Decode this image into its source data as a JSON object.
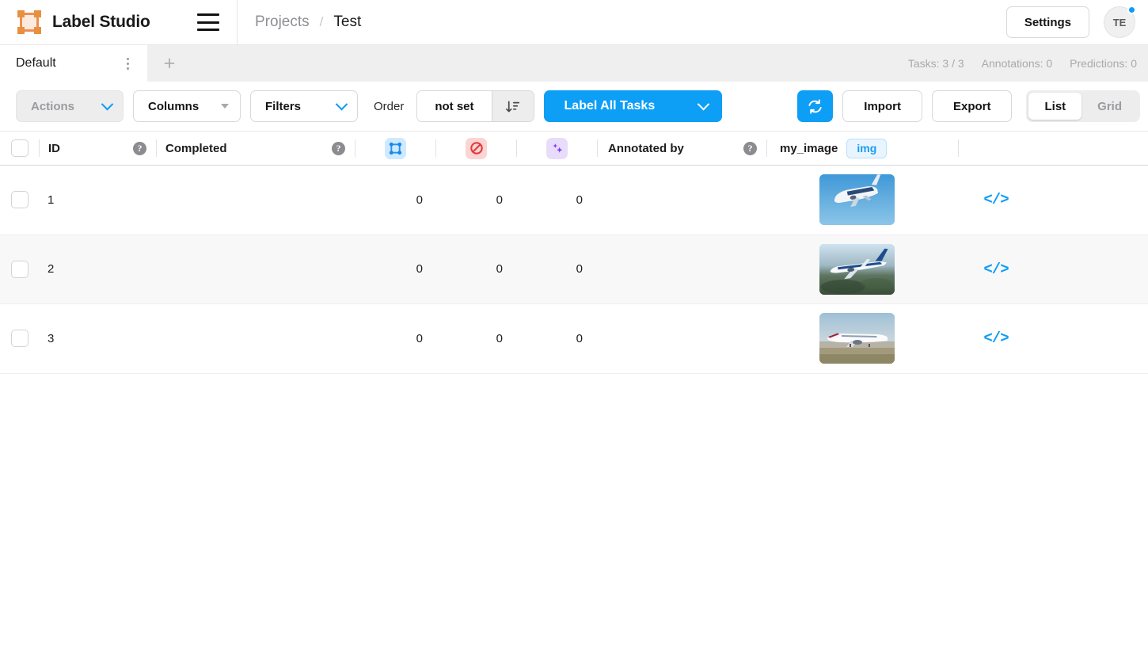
{
  "header": {
    "brand": "Label Studio",
    "logo_icon": "label-studio-logo-icon",
    "menu_icon": "hamburger-menu-icon",
    "breadcrumb": {
      "root": "Projects",
      "separator": "/",
      "current": "Test"
    },
    "settings_label": "Settings",
    "avatar_initials": "TE"
  },
  "tabs": {
    "items": [
      {
        "label": "Default",
        "active": true
      }
    ],
    "kebab_icon": "tab-options-icon",
    "add_label": "+",
    "stats": {
      "tasks": "Tasks: 3 / 3",
      "annotations": "Annotations: 0",
      "predictions": "Predictions: 0"
    }
  },
  "toolbar": {
    "actions_label": "Actions",
    "columns_label": "Columns",
    "filters_label": "Filters",
    "order_label": "Order",
    "order_value": "not set",
    "sort_icon": "sort-descending-icon",
    "label_all_label": "Label All Tasks",
    "refresh_icon": "refresh-icon",
    "import_label": "Import",
    "export_label": "Export",
    "view_list_label": "List",
    "view_grid_label": "Grid",
    "accent_color": "#0d9ef6"
  },
  "table": {
    "columns": {
      "id": "ID",
      "completed": "Completed",
      "annotations_icon": "annotations-bbox-icon",
      "cancelled_icon": "cancelled-skipped-icon",
      "predictions_icon": "predictions-sparkle-icon",
      "annotated_by": "Annotated by",
      "data_field": "my_image",
      "data_field_type": "img"
    },
    "help_glyph": "?",
    "code_icon": "code-view-icon",
    "rows": [
      {
        "id": "1",
        "completed": "",
        "annotations": "0",
        "cancelled": "0",
        "predictions": "0",
        "annotated_by": "",
        "image_alt": "airbus-beluga-aircraft-in-flight",
        "image_style": "beluga"
      },
      {
        "id": "2",
        "completed": "",
        "annotations": "0",
        "cancelled": "0",
        "predictions": "0",
        "annotated_by": "",
        "image_alt": "boeing-airliner-in-flight-over-terrain",
        "image_style": "cruise"
      },
      {
        "id": "3",
        "completed": "",
        "annotations": "0",
        "cancelled": "0",
        "predictions": "0",
        "annotated_by": "",
        "image_alt": "white-airliner-on-runway",
        "image_style": "runway"
      }
    ]
  }
}
